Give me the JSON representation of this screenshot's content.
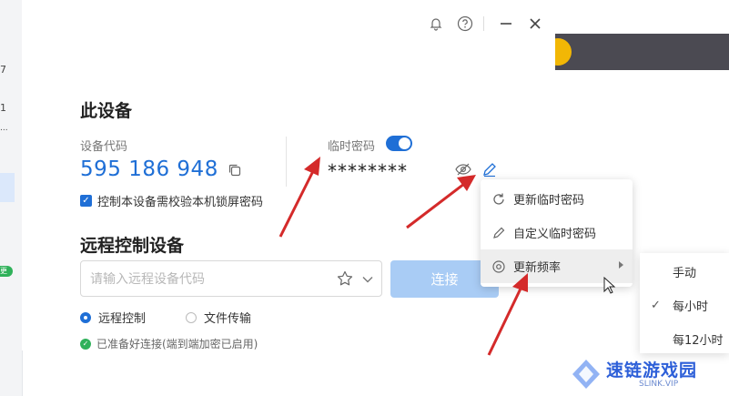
{
  "left_strip": {
    "frag_top": "7",
    "frag_mid": "1",
    "frag_dots": "...",
    "frag_badge": "更"
  },
  "title_bar": {
    "bell_icon": "bell-icon",
    "help_icon": "question-circle-icon",
    "minimize_icon": "minimize-icon",
    "close_icon": "close-icon"
  },
  "this_device": {
    "title": "此设备",
    "device_code_label": "设备代码",
    "device_code": "595 186 948",
    "temp_password_label": "临时密码",
    "temp_password_enabled": true,
    "temp_password": "********",
    "lock_screen_checkbox_label": "控制本设备需校验本机锁屏密码",
    "lock_screen_checked": true
  },
  "remote": {
    "title": "远程控制设备",
    "input_placeholder": "请输入远程设备代码",
    "connect_label": "连接",
    "mode_remote_control": "远程控制",
    "mode_file_transfer": "文件传输",
    "selected_mode": "远程控制",
    "status_text": "已准备好连接(端到端加密已启用)"
  },
  "context_menu": {
    "items": [
      {
        "label": "更新临时密码",
        "icon": "refresh-icon"
      },
      {
        "label": "自定义临时密码",
        "icon": "pencil-icon"
      },
      {
        "label": "更新频率",
        "icon": "frequency-icon",
        "has_submenu": true,
        "highlighted": true
      }
    ]
  },
  "submenu": {
    "items": [
      {
        "label": "手动",
        "checked": false
      },
      {
        "label": "每小时",
        "checked": true
      },
      {
        "label": "每12小时",
        "checked": false
      }
    ]
  },
  "watermark": {
    "title": "速链游戏园",
    "subtitle": "SLINK.VIP"
  },
  "colors": {
    "accent": "#1f6fd6",
    "connect_disabled": "#a9ccf5",
    "annotation_arrow": "#d42a2a",
    "success": "#2fb15a"
  }
}
